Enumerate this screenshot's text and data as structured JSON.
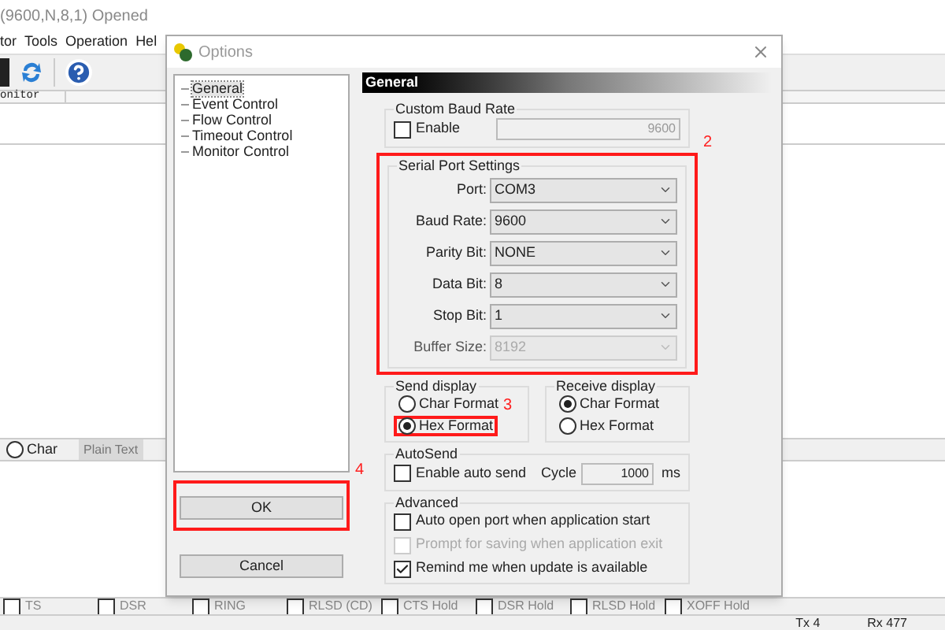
{
  "app": {
    "title": "(9600,N,8,1) Opened",
    "menu": [
      "tor",
      "Tools",
      "Operation",
      "Hel"
    ],
    "column_header": "onitor",
    "display_mode": {
      "label": "Char",
      "selected": false
    },
    "view_tab": "Plain Text",
    "status_lines": [
      {
        "label": "TS",
        "checked": false
      },
      {
        "label": "DSR",
        "checked": false
      },
      {
        "label": "RING",
        "checked": false
      },
      {
        "label": "RLSD (CD)",
        "checked": false
      },
      {
        "label": "CTS Hold",
        "checked": false
      },
      {
        "label": "DSR Hold",
        "checked": false
      },
      {
        "label": "RLSD Hold",
        "checked": false
      },
      {
        "label": "XOFF Hold",
        "checked": false
      }
    ],
    "counters": [
      "Tx 4",
      "Rx 477"
    ]
  },
  "dialog": {
    "title": "Options",
    "tree": [
      {
        "label": "General",
        "selected": true
      },
      {
        "label": "Event Control",
        "selected": false
      },
      {
        "label": "Flow Control",
        "selected": false
      },
      {
        "label": "Timeout Control",
        "selected": false
      },
      {
        "label": "Monitor Control",
        "selected": false
      }
    ],
    "buttons": [
      {
        "label": "OK",
        "highlighted": true,
        "annotation": "4"
      },
      {
        "label": "Cancel",
        "highlighted": false
      }
    ],
    "page_title": "General",
    "custom_baud_rate": {
      "title": "Custom Baud Rate",
      "enable": {
        "label": "Enable",
        "checked": false
      },
      "value": "9600",
      "disabled": true
    },
    "serial_port_settings": {
      "title": "Serial Port Settings",
      "highlighted": true,
      "annotation": "2",
      "fields": [
        {
          "label": "Port:",
          "value": "COM3",
          "disabled": false
        },
        {
          "label": "Baud Rate:",
          "value": "9600",
          "disabled": false
        },
        {
          "label": "Parity Bit:",
          "value": "NONE",
          "disabled": false
        },
        {
          "label": "Data Bit:",
          "value": "8",
          "disabled": false
        },
        {
          "label": "Stop Bit:",
          "value": "1",
          "disabled": false
        },
        {
          "label": "Buffer Size:",
          "value": "8192",
          "disabled": true
        }
      ]
    },
    "send_display": {
      "title": "Send display",
      "options": [
        {
          "label": "Char Format",
          "selected": false,
          "highlighted": false
        },
        {
          "label": "Hex Format",
          "selected": true,
          "highlighted": true,
          "annotation": "3"
        }
      ]
    },
    "receive_display": {
      "title": "Receive display",
      "options": [
        {
          "label": "Char Format",
          "selected": true,
          "highlighted": false
        },
        {
          "label": "Hex Format",
          "selected": false,
          "highlighted": false
        }
      ]
    },
    "autosend": {
      "title": "AutoSend",
      "enable": {
        "label": "Enable auto send",
        "checked": false
      },
      "cycle_label": "Cycle",
      "cycle": "1000",
      "unit": "ms"
    },
    "advanced": {
      "title": "Advanced",
      "options": [
        {
          "label": "Auto open port when application start",
          "checked": false,
          "disabled": false
        },
        {
          "label": "Prompt for saving when application exit",
          "checked": false,
          "disabled": true
        },
        {
          "label": "Remind me when update is available",
          "checked": true,
          "disabled": false
        }
      ]
    }
  }
}
